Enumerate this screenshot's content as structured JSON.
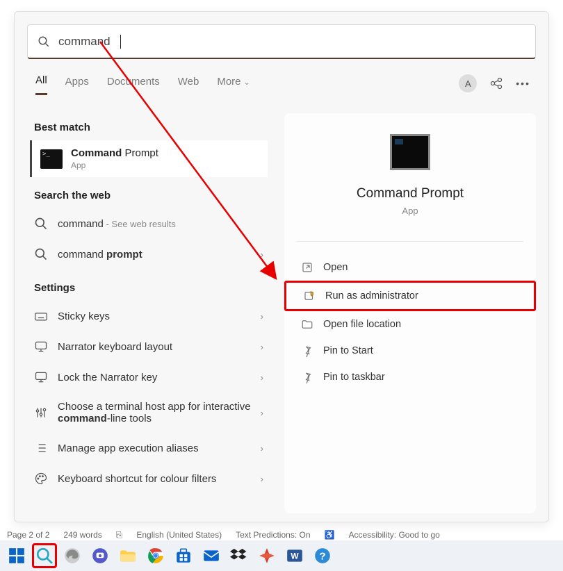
{
  "search": {
    "query": "command"
  },
  "tabs": {
    "all": "All",
    "apps": "Apps",
    "documents": "Documents",
    "web": "Web",
    "more": "More"
  },
  "avatar_letter": "A",
  "sections": {
    "best_match": "Best match",
    "search_web": "Search the web",
    "settings": "Settings"
  },
  "best_match": {
    "title_a": "Command",
    "title_b": " Prompt",
    "subtitle": "App"
  },
  "web_results": [
    {
      "term": "command",
      "suffix": " - See web results"
    },
    {
      "term_a": "command ",
      "term_b": "prompt"
    }
  ],
  "settings_items": [
    {
      "label": "Sticky keys"
    },
    {
      "label": "Narrator keyboard layout"
    },
    {
      "label": "Lock the Narrator key"
    },
    {
      "label_a": "Choose a terminal host app for interactive ",
      "label_b": "command",
      "label_c": "-line tools"
    },
    {
      "label": "Manage app execution aliases"
    },
    {
      "label": "Keyboard shortcut for colour filters"
    }
  ],
  "preview": {
    "title": "Command Prompt",
    "subtitle": "App"
  },
  "actions": {
    "open": "Open",
    "run_admin": "Run as administrator",
    "open_loc": "Open file location",
    "pin_start": "Pin to Start",
    "pin_taskbar": "Pin to taskbar"
  },
  "statusbar": {
    "page": "Page 2 of 2",
    "words": "249 words",
    "lang": "English (United States)",
    "pred": "Text Predictions: On",
    "acc": "Accessibility: Good to go"
  }
}
